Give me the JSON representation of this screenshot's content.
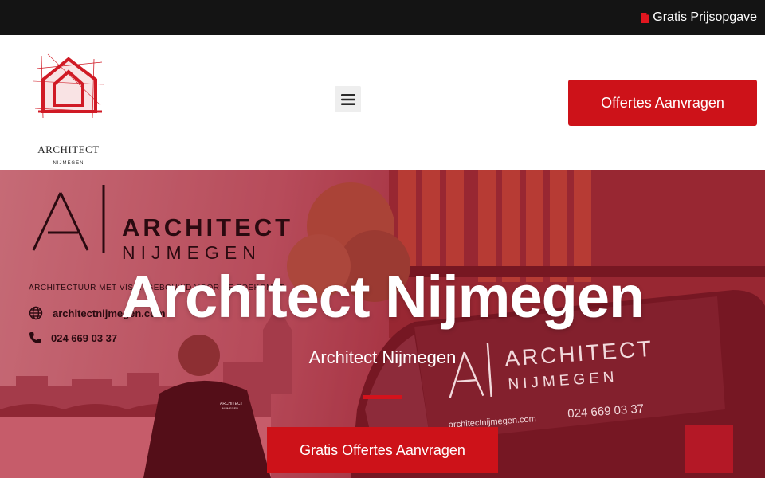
{
  "topbar": {
    "link_label": "Gratis Prijsopgave",
    "icon": "document-icon"
  },
  "header": {
    "logo": {
      "title": "ARCHITECT",
      "subtitle": "NIJMEGEN"
    },
    "menu_icon": "hamburger-menu-icon",
    "cta_label": "Offertes Aanvragen"
  },
  "hero": {
    "brand": {
      "word1": "ARCHITECT",
      "word2": "NIJMEGEN",
      "tagline": "ARCHITECTUUR MET VISIE. GEBOUWD VOOR DE TOEKOMST.",
      "website": "architectnijmegen.com",
      "phone": "024 669 03 37"
    },
    "van": {
      "word1": "ARCHITECT",
      "word2": "NIJMEGEN",
      "website": "architectnijmegen.com",
      "phone": "024 669 03 37"
    },
    "jacket_logo": {
      "line1": "ARCHITECT",
      "line2": "NIJMEGEN"
    },
    "title": "Architect Nijmegen",
    "subtitle": "Architect Nijmegen",
    "cta_label": "Gratis Offertes Aanvragen"
  },
  "colors": {
    "accent": "#cd1219",
    "topbar": "#141414",
    "text_light": "#ffffff"
  }
}
